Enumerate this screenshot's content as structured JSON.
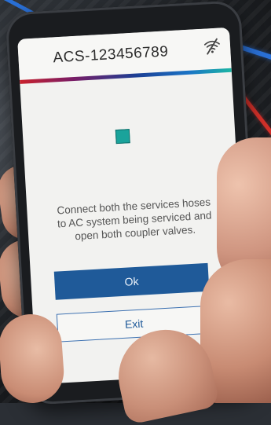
{
  "header": {
    "title": "ACS-123456789",
    "connection_icon": "wifi-off-icon"
  },
  "colors": {
    "primary_button": "#1f5a99",
    "status_indicator": "#1aa39b",
    "gradient_bar": [
      "#c9212c",
      "#7a1d66",
      "#1c3f94",
      "#1a74c6",
      "#1db6a4"
    ]
  },
  "main": {
    "status_icon": "status-square-icon",
    "message": "Connect both the services hoses to AC system being serviced and open both coupler valves."
  },
  "actions": {
    "ok_label": "Ok",
    "exit_label": "Exit"
  }
}
